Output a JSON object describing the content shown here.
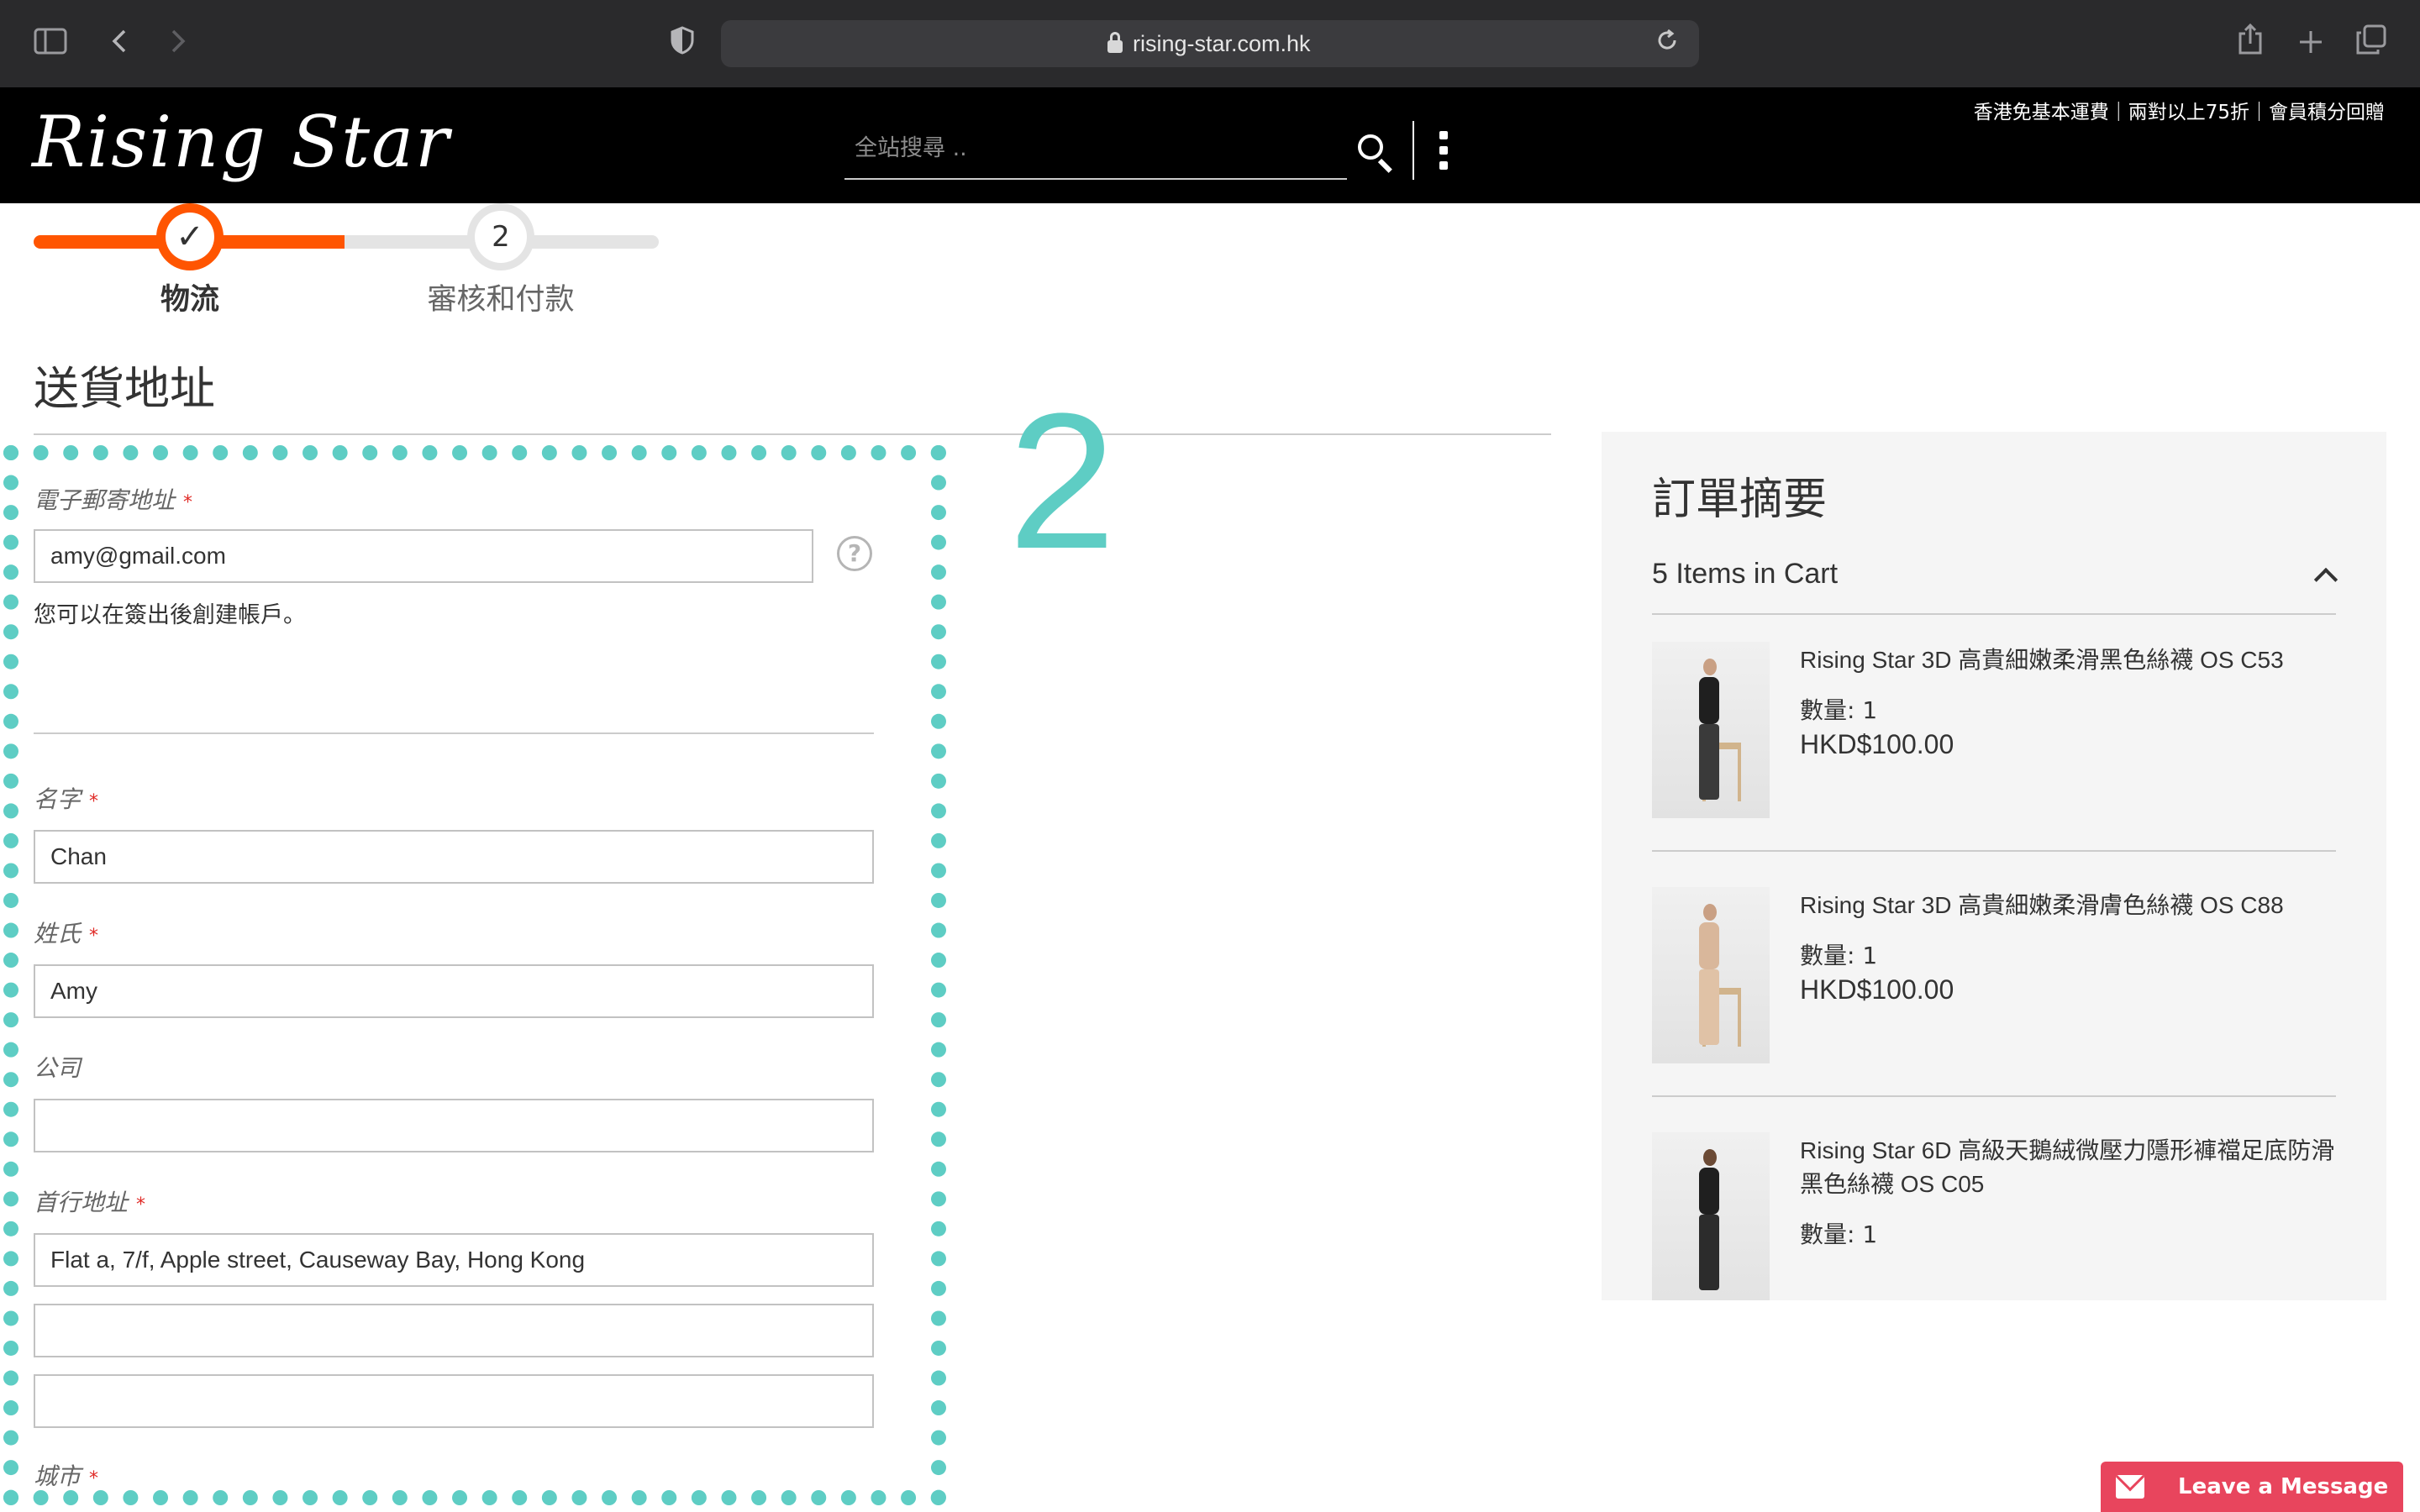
{
  "browser": {
    "url": "rising-star.com.hk",
    "icons": [
      "sidebar-icon",
      "back-icon",
      "forward-icon",
      "shield-icon",
      "lock-icon",
      "reload-icon",
      "share-icon",
      "new-tab-icon",
      "tabs-icon"
    ]
  },
  "header": {
    "logo": "Rising Star",
    "promo": "香港免基本運費｜兩對以上75折｜會員積分回贈",
    "search_placeholder": "全站搜尋 .."
  },
  "progress": {
    "step1_label": "物流",
    "step2_number": "2",
    "step2_label": "審核和付款",
    "accent": "#ff5501"
  },
  "page_title": "送貨地址",
  "form": {
    "email_label": "電子郵寄地址",
    "email_value": "amy@gmail.com",
    "email_note": "您可以在簽出後創建帳戶。",
    "firstname_label": "名字",
    "firstname_value": "Chan",
    "lastname_label": "姓氏",
    "lastname_value": "Amy",
    "company_label": "公司",
    "company_value": "",
    "street_label": "首行地址",
    "street_value_1": "Flat a, 7/f, Apple street, Causeway Bay, Hong Kong",
    "street_value_2": "",
    "street_value_3": "",
    "city_label": "城市",
    "required_mark": "*"
  },
  "annotation": {
    "number": "2",
    "color": "#5ecdc4"
  },
  "summary": {
    "title": "訂單摘要",
    "cart_count": "5 Items in Cart",
    "qty_label": "數量: 1",
    "items": [
      {
        "name": "Rising Star 3D 高貴細嫩柔滑黑色絲襪 OS C53",
        "qty": "數量: 1",
        "price": "HKD$100.00"
      },
      {
        "name": "Rising Star 3D 高貴細嫩柔滑膚色絲襪 OS C88",
        "qty": "數量: 1",
        "price": "HKD$100.00"
      },
      {
        "name": "Rising Star 6D 高級天鵝絨微壓力隱形褲襠足底防滑黑色絲襪 OS C05",
        "qty": "數量: 1",
        "price": ""
      }
    ]
  },
  "leave_message": "Leave a Message"
}
